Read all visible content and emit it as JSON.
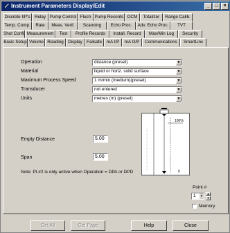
{
  "window": {
    "title": "Instrument Parameters Display/Edit",
    "min": "_",
    "max": "□",
    "close": "×"
  },
  "tabs": {
    "row1": [
      "Discrete I/P's",
      "Relay",
      "Pump Control",
      "Flush",
      "Pump Records",
      "OCM",
      "Totalizer",
      "Range Calib."
    ],
    "row2": [
      "Temp. Comp.",
      "Rate",
      "Meas. Verif.",
      "Scanning",
      "Echo Proc.",
      "Adv. Echo Proc.",
      "TVT"
    ],
    "row3": [
      "Shot Config.",
      "Measurement",
      "Test",
      "Profile Records",
      "Install. Record",
      "Max/Min Log",
      "Security"
    ],
    "row4": [
      "Basic Setup",
      "Volume",
      "Reading",
      "Display",
      "Failsafe",
      "mA I/P",
      "mA O/P",
      "Communications",
      "SmartLinx"
    ]
  },
  "form": {
    "operation": {
      "label": "Operation",
      "value": "distance (preset)"
    },
    "material": {
      "label": "Material",
      "value": "liquid or horiz. solid surface"
    },
    "speed": {
      "label": "Maximum Process Speed",
      "value": "1   m/min (medium)(preset)"
    },
    "transducer": {
      "label": "Transducer",
      "value": "not entered"
    },
    "units": {
      "label": "Units",
      "value": "metres (m) (preset)"
    },
    "empty": {
      "label": "Empty Distance",
      "value": "5.00"
    },
    "span": {
      "label": "Span",
      "value": "5.00"
    },
    "note": "Note: Pt.#2 is only active when Operation = DPA or DPD"
  },
  "diagram": {
    "pct_label": "100%",
    "zero_label": "0"
  },
  "point": {
    "label": "Point #",
    "value": "1",
    "memory_label": "Memory"
  },
  "buttons": {
    "get_all": "Get All",
    "get_page": "Get Page",
    "help": "Help",
    "close": "Close"
  }
}
